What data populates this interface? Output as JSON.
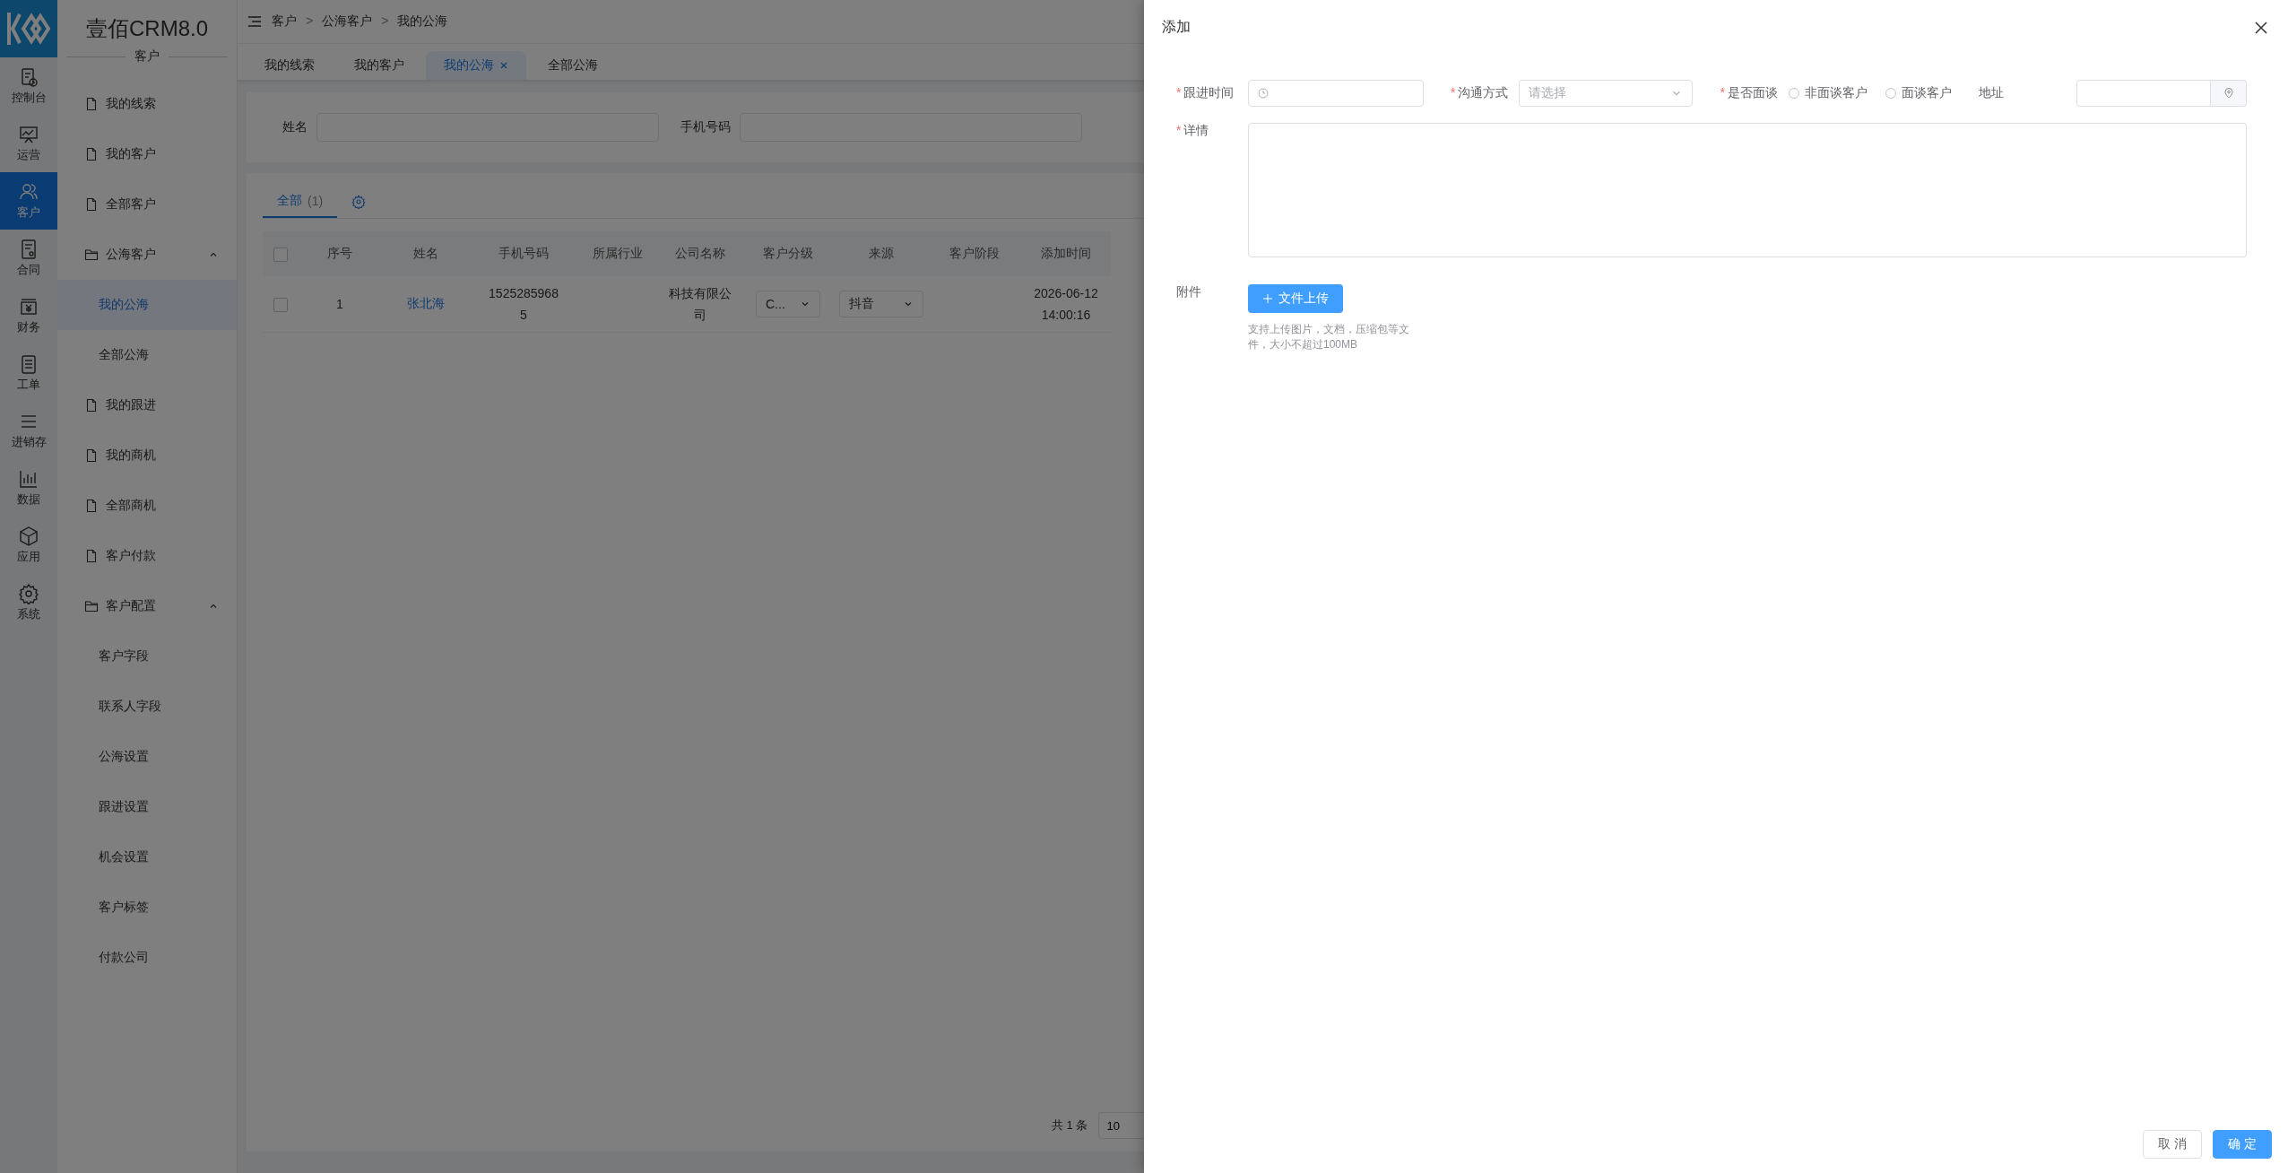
{
  "app": {
    "title": "壹佰CRM8.0"
  },
  "rail": [
    {
      "label": "控制台",
      "selected": false
    },
    {
      "label": "运营",
      "selected": false
    },
    {
      "label": "客户",
      "selected": true
    },
    {
      "label": "合同",
      "selected": false
    },
    {
      "label": "财务",
      "selected": false
    },
    {
      "label": "工单",
      "selected": false
    },
    {
      "label": "进销存",
      "selected": false
    },
    {
      "label": "数据",
      "selected": false
    },
    {
      "label": "应用",
      "selected": false
    },
    {
      "label": "系统",
      "selected": false
    }
  ],
  "sidebar": {
    "heading": "客户",
    "items": [
      {
        "kind": "page",
        "label": "我的线索",
        "selected": false
      },
      {
        "kind": "page",
        "label": "我的客户",
        "selected": false
      },
      {
        "kind": "page",
        "label": "全部客户",
        "selected": false
      },
      {
        "kind": "group",
        "label": "公海客户",
        "expanded": true,
        "children": [
          {
            "label": "我的公海",
            "selected": true
          },
          {
            "label": "全部公海",
            "selected": false
          }
        ]
      },
      {
        "kind": "page",
        "label": "我的跟进",
        "selected": false
      },
      {
        "kind": "page",
        "label": "我的商机",
        "selected": false
      },
      {
        "kind": "page",
        "label": "全部商机",
        "selected": false
      },
      {
        "kind": "page",
        "label": "客户付款",
        "selected": false
      },
      {
        "kind": "group",
        "label": "客户配置",
        "expanded": true,
        "children": [
          {
            "label": "客户字段",
            "selected": false
          },
          {
            "label": "联系人字段",
            "selected": false
          },
          {
            "label": "公海设置",
            "selected": false
          },
          {
            "label": "跟进设置",
            "selected": false
          },
          {
            "label": "机会设置",
            "selected": false
          },
          {
            "label": "客户标签",
            "selected": false
          },
          {
            "label": "付款公司",
            "selected": false
          }
        ]
      }
    ]
  },
  "breadcrumb": [
    "客户",
    "公海客户",
    "我的公海"
  ],
  "breadcrumb_separator": ">",
  "tabs": [
    {
      "label": "我的线索",
      "selected": false
    },
    {
      "label": "我的客户",
      "selected": false
    },
    {
      "label": "我的公海",
      "selected": true
    },
    {
      "label": "全部公海",
      "selected": false
    }
  ],
  "filters": [
    {
      "label": "姓名"
    },
    {
      "label": "手机号码"
    }
  ],
  "list_tabs": [
    {
      "label": "全部",
      "count": "(1)",
      "selected": true
    }
  ],
  "table": {
    "header_checked": false,
    "columns": [
      "序号",
      "姓名",
      "手机号码",
      "所属行业",
      "公司名称",
      "客户分级",
      "来源",
      "客户阶段",
      "添加时间"
    ],
    "rows": [
      {
        "checked": false,
        "index": "1",
        "name": "张北海",
        "phone": "15252859685",
        "industry": "",
        "company": "科技有限公司",
        "grade": "C...",
        "source": "抖音",
        "stage": "",
        "added": "2026-06-12 14:00:16"
      }
    ]
  },
  "pagination": {
    "total": "共 1 条",
    "page_size": "10"
  },
  "drawer": {
    "title": "添加",
    "required_mark": "*",
    "follow_time": {
      "label": "跟进时间",
      "required": true
    },
    "method": {
      "label": "沟通方式",
      "required": true,
      "placeholder": "请选择"
    },
    "interview": {
      "label": "是否面谈",
      "required": true,
      "options": [
        {
          "label": "非面谈客户",
          "selected": false
        },
        {
          "label": "面谈客户",
          "selected": false
        }
      ]
    },
    "address": {
      "label": "地址"
    },
    "detail": {
      "label": "详情",
      "required": true
    },
    "attachment": {
      "label": "附件",
      "button": "文件上传",
      "hint": "支持上传图片，文档，压缩包等文件，大小不超过100MB"
    },
    "buttons": [
      {
        "label": "取 消",
        "kind": "default"
      },
      {
        "label": "确 定",
        "kind": "primary"
      }
    ]
  }
}
